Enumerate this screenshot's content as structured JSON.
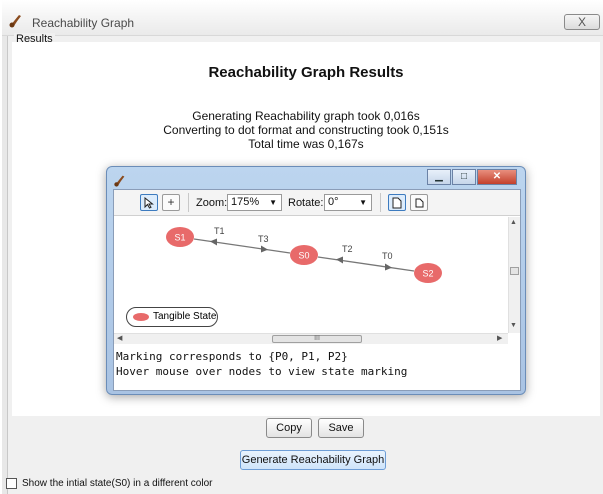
{
  "window": {
    "title": "Reachability Graph",
    "close_glyph": "X"
  },
  "results": {
    "legend": "Results",
    "heading": "Reachability Graph Results",
    "timing_lines": [
      "Generating Reachability graph took 0,016s",
      "Converting to dot format and constructing took 0,151s",
      "Total time was 0,167s"
    ]
  },
  "viewer": {
    "toolbar": {
      "zoom_label": "Zoom:",
      "zoom_value": "175%",
      "rotate_label": "Rotate:",
      "rotate_value": "0°"
    },
    "graph": {
      "nodes": [
        {
          "id": "S1"
        },
        {
          "id": "S0"
        },
        {
          "id": "S2"
        }
      ],
      "transitions": [
        "T1",
        "T3",
        "T2",
        "T0"
      ],
      "node_color": "#e86a6a",
      "edge_color": "#777777"
    },
    "legend_label": "Tangible State",
    "hscroll_grip": "III",
    "console_lines": [
      "Marking corresponds to {P0, P1, P2}",
      "Hover mouse over nodes to view state marking"
    ]
  },
  "buttons": {
    "copy": "Copy",
    "save": "Save",
    "generate": "Generate Reachability Graph"
  },
  "option": {
    "checkbox_label": "Show the intial state(S0) in a different color",
    "checked": false
  }
}
